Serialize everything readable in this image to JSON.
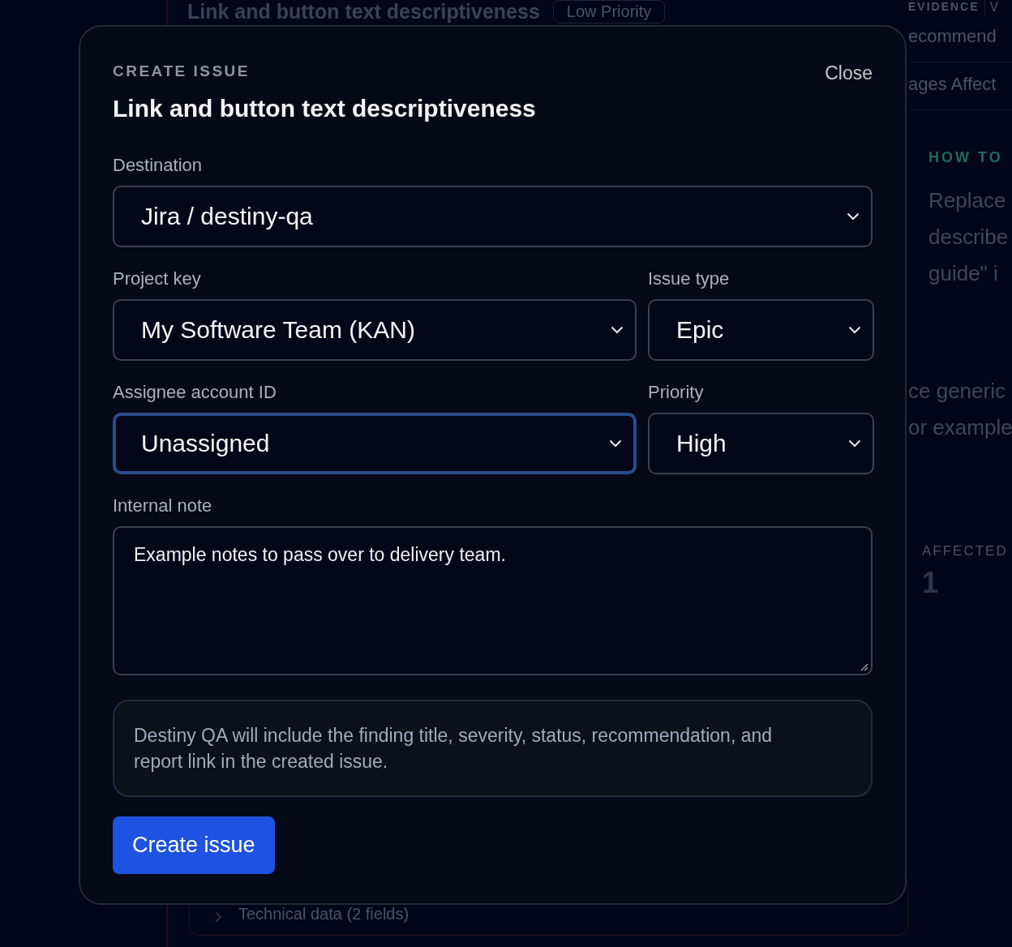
{
  "background": {
    "finding_title": "Link and button text descriptiveness",
    "priority_badge": "Low Priority",
    "evidence_tab": "EVIDENCE",
    "next_tab": "V",
    "side_rows": [
      "ecommend",
      "ages Affect"
    ],
    "how_to_heading": "HOW TO",
    "how_to_lines": [
      "Replace",
      "describe",
      "guide\" i"
    ],
    "example_lines": [
      "ce generic",
      "or example"
    ],
    "affected_label": "AFFECTED",
    "affected_value": "1",
    "technical_toggle": "Technical data (2 fields)"
  },
  "dialog": {
    "eyebrow": "CREATE ISSUE",
    "title": "Link and button text descriptiveness",
    "close": "Close",
    "field_rows": [
      [
        {
          "label": "Destination",
          "value": "Jira / destiny-qa",
          "kind": "select",
          "focused": false
        }
      ],
      [
        {
          "label": "Project key",
          "value": "My Software Team (KAN)",
          "kind": "select",
          "focused": false
        },
        {
          "label": "Issue type",
          "value": "Epic",
          "kind": "select",
          "focused": false
        }
      ],
      [
        {
          "label": "Assignee account ID",
          "value": "Unassigned",
          "kind": "select",
          "focused": true
        },
        {
          "label": "Priority",
          "value": "High",
          "kind": "select",
          "focused": false
        }
      ],
      [
        {
          "label": "Internal note",
          "value": "Example notes to pass over to delivery team.",
          "kind": "textarea",
          "focused": false
        }
      ]
    ],
    "info": "Destiny QA will include the finding title, severity, status, recommendation, and report link in the created issue.",
    "submit": "Create issue"
  }
}
